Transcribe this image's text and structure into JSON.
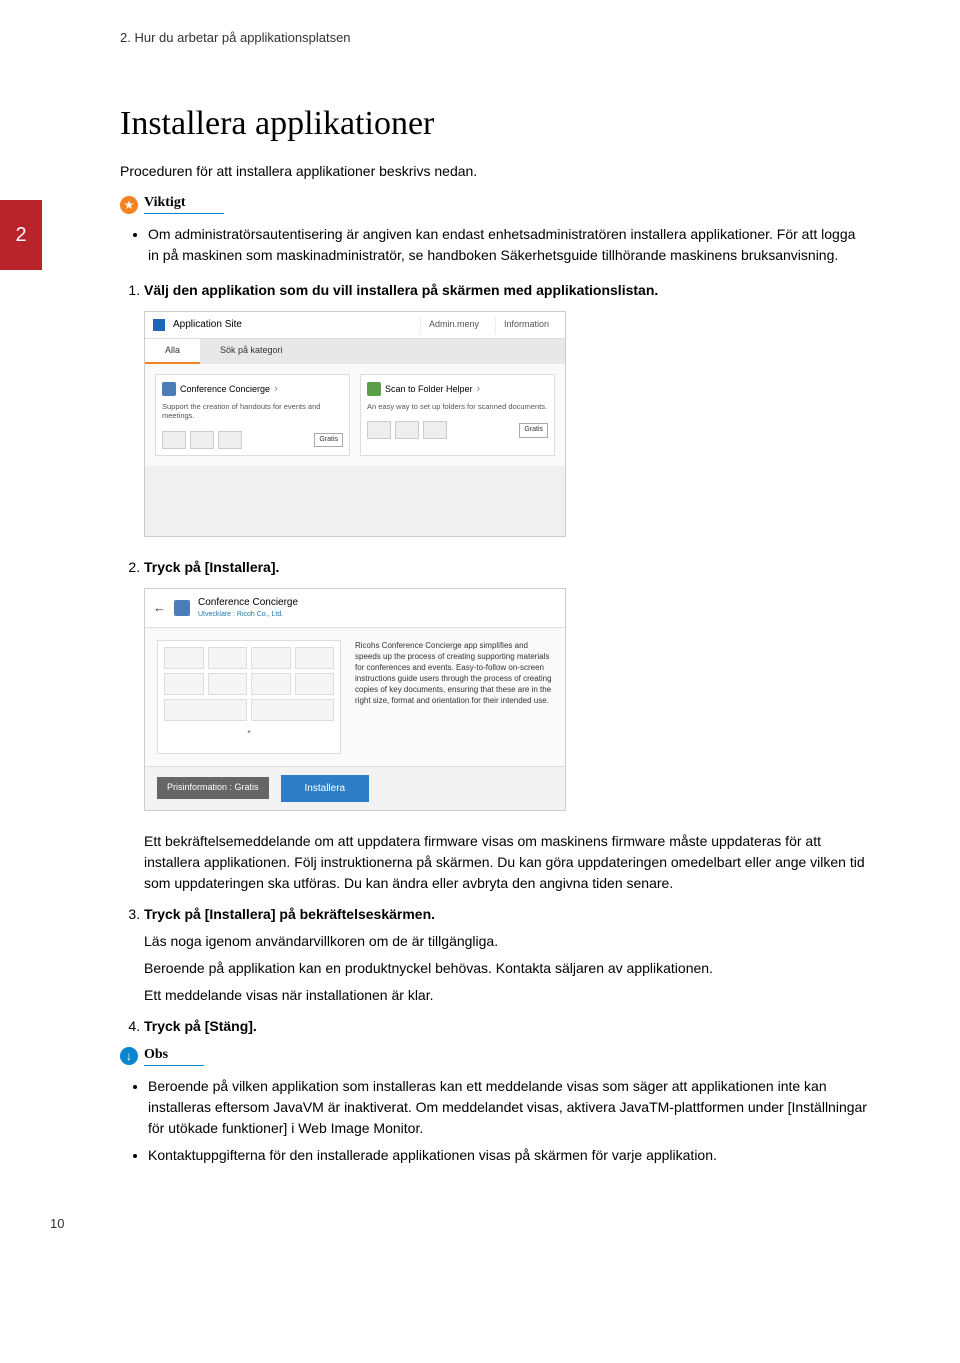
{
  "header": "2. Hur du arbetar på applikationsplatsen",
  "chapter_tab": "2",
  "title": "Installera applikationer",
  "intro": "Proceduren för att installera applikationer beskrivs nedan.",
  "important": {
    "label": "Viktigt",
    "items": [
      "Om administratörsautentisering är angiven kan endast enhetsadministratören installera applikationer. För att logga in på maskinen som maskinadministratör, se handboken Säkerhetsguide tillhörande maskinens bruksanvisning."
    ]
  },
  "steps": {
    "s1": {
      "title": "Välj den applikation som du vill installera på skärmen med applikationslistan."
    },
    "s2": {
      "title": "Tryck på [Installera].",
      "body": "Ett bekräftelsemeddelande om att uppdatera firmware visas om maskinens firmware måste uppdateras för att installera applikationen. Följ instruktionerna på skärmen. Du kan göra uppdateringen omedelbart eller ange vilken tid som uppdateringen ska utföras. Du kan ändra eller avbryta den angivna tiden senare."
    },
    "s3": {
      "title": "Tryck på [Installera] på bekräftelseskärmen.",
      "body1": "Läs noga igenom användarvillkoren om de är tillgängliga.",
      "body2": "Beroende på applikation kan en produktnyckel behövas. Kontakta säljaren av applikationen.",
      "body3": "Ett meddelande visas när installationen är klar."
    },
    "s4": {
      "title": "Tryck på [Stäng]."
    }
  },
  "note": {
    "label": "Obs",
    "items": [
      "Beroende på vilken applikation som installeras kan ett meddelande visas som säger att applikationen inte kan installeras eftersom JavaVM är inaktiverat. Om meddelandet visas, aktivera JavaTM-plattformen under [Inställningar för utökade funktioner] i Web Image Monitor.",
      "Kontaktuppgifterna för den installerade applikationen visas på skärmen för varje applikation."
    ]
  },
  "screenshot1": {
    "title": "Application Site",
    "menu1": "Admin.meny",
    "menu2": "Information",
    "tab1": "Alla",
    "tab2": "Sök på kategori",
    "card1_title": "Conference Concierge",
    "card1_desc": "Support the creation of handouts for events and meetings.",
    "card2_title": "Scan to Folder Helper",
    "card2_desc": "An easy way to set up folders for scanned documents.",
    "gratis": "Gratis"
  },
  "screenshot2": {
    "title": "Conference Concierge",
    "subtitle": "Utvecklare : Ricoh Co., Ltd.",
    "desc": "Ricohs Conference Concierge app simplifies and speeds up the process of creating supporting materials for conferences and events. Easy-to-follow on-screen instructions guide users through the process of creating copies of key documents, ensuring that these are in the right size, format and orientation for their intended use.",
    "price": "Prisinformation : Gratis",
    "install": "Installera"
  },
  "page_number": "10"
}
